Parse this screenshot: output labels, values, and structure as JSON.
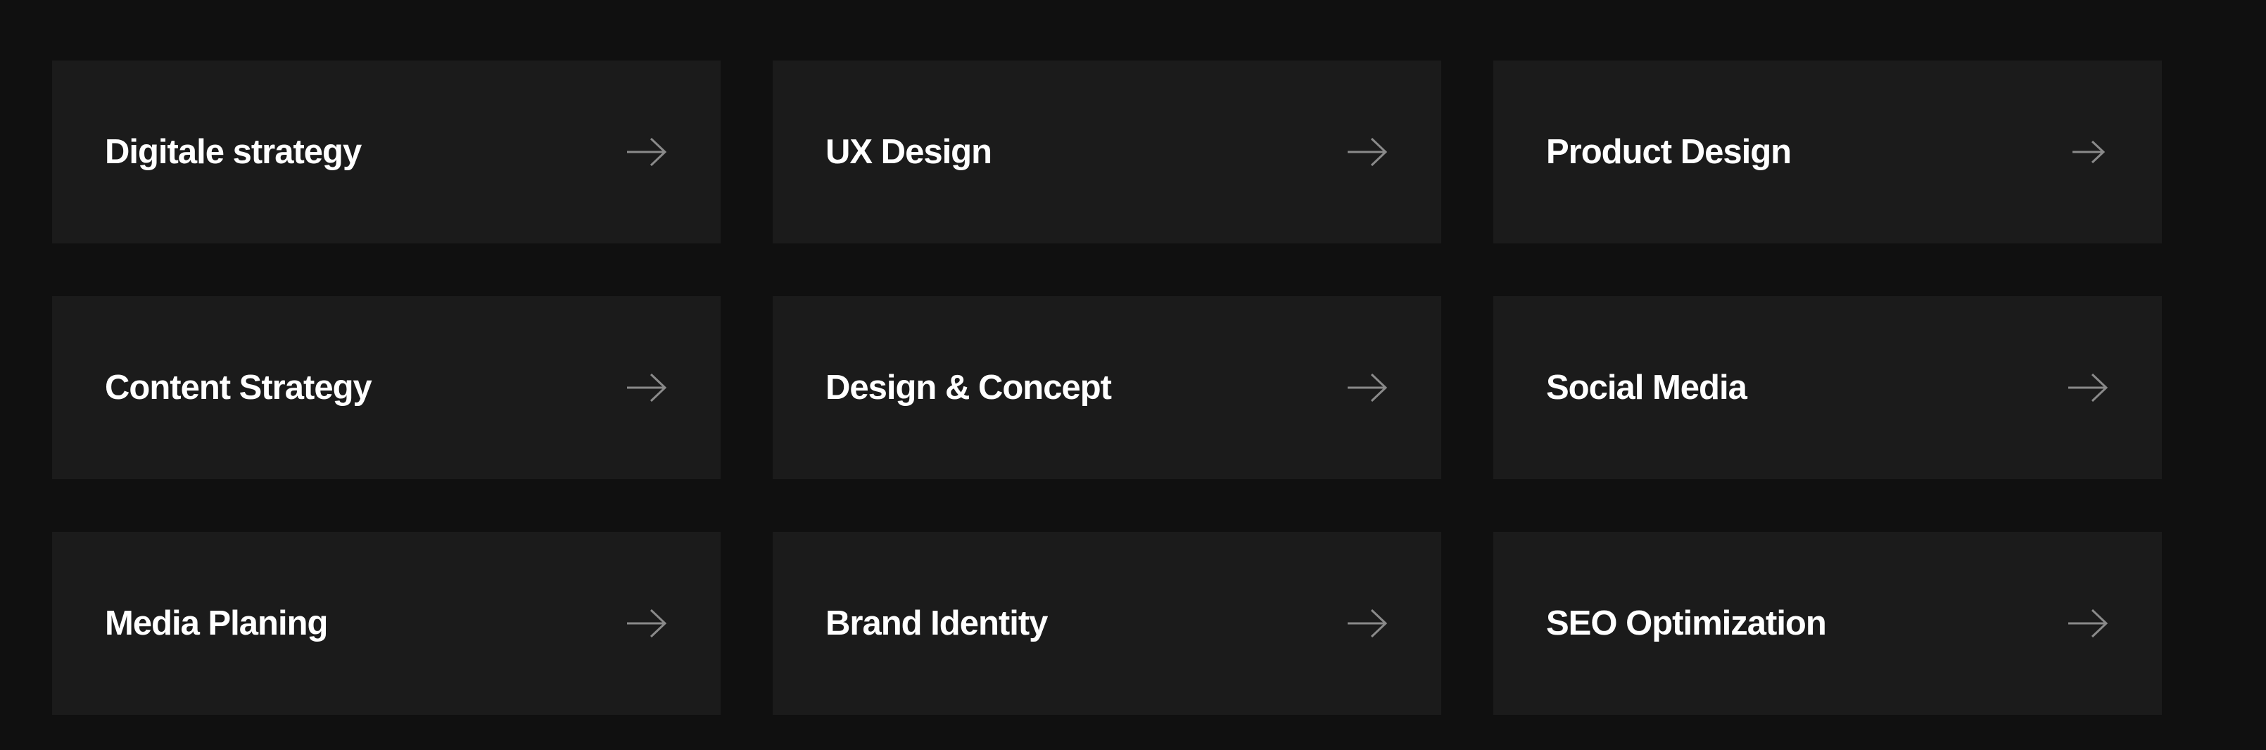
{
  "services": {
    "items": [
      {
        "label": "Digitale strategy",
        "icon": "arrow-right-icon"
      },
      {
        "label": "UX Design",
        "icon": "arrow-right-icon"
      },
      {
        "label": "Product Design",
        "icon": "arrow-right-icon"
      },
      {
        "label": "Content Strategy",
        "icon": "arrow-right-icon"
      },
      {
        "label": "Design & Concept",
        "icon": "arrow-right-icon"
      },
      {
        "label": "Social Media",
        "icon": "arrow-right-icon"
      },
      {
        "label": "Media Planing",
        "icon": "arrow-right-icon"
      },
      {
        "label": "Brand Identity",
        "icon": "arrow-right-icon"
      },
      {
        "label": "SEO Optimization",
        "icon": "arrow-right-icon"
      }
    ]
  },
  "colors": {
    "page_background": "#101010",
    "card_background": "#1b1b1b",
    "label_text": "#ffffff",
    "arrow": "#8a8a8a"
  }
}
